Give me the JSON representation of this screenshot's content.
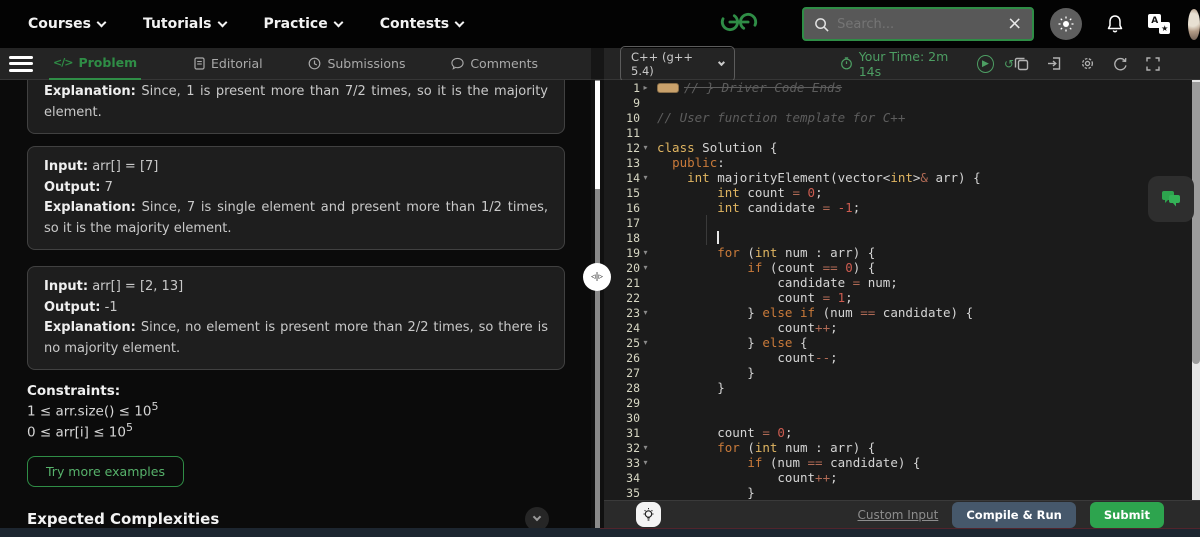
{
  "colors": {
    "brand_green": "#2f8d46",
    "timer_green": "#4d9e63",
    "submit_green": "#2da44e",
    "compile_blue": "#46586b",
    "keyword_orange": "#c97a3a",
    "type_gold": "#e0b561",
    "number_red": "#cd5c50"
  },
  "topnav": {
    "items": [
      "Courses",
      "Tutorials",
      "Practice",
      "Contests"
    ],
    "search_placeholder": "Search...",
    "search_value": "",
    "clear_glyph": "×"
  },
  "tabs": {
    "problem_icon": "</>",
    "problem": "Problem",
    "editorial": "Editorial",
    "submissions": "Submissions",
    "comments": "Comments"
  },
  "problem": {
    "partial": {
      "bold": "Explanation:",
      "text": " Since, 1 is present more than 7/2 times, so it is the majority element."
    },
    "examples": [
      {
        "input_label": "Input:",
        "input": " arr[] = [7]",
        "output_label": "Output:",
        "output": " 7",
        "expl_label": "Explanation:",
        "expl": " Since, 7 is single element and present more than 1/2 times, so it is the majority element."
      },
      {
        "input_label": "Input:",
        "input": " arr[] = [2, 13]",
        "output_label": "Output:",
        "output": " -1",
        "expl_label": "Explanation:",
        "expl": " Since, no element is present more than 2/2 times, so there is no majority element."
      }
    ],
    "constraints_label": "Constraints:",
    "constraints": [
      {
        "pre": "1 ≤ arr.size() ≤ 10",
        "sup": "5"
      },
      {
        "pre": "0 ≤ arr[i] ≤ 10",
        "sup": "5"
      }
    ],
    "try_more": "Try more examples",
    "expected_complexities": "Expected Complexities"
  },
  "editor": {
    "language": "C++ (g++ 5.4)",
    "timer_label": "Your Time: 2m 14s",
    "play_glyph": "▶",
    "history_glyph": "↺",
    "fold_open_glyph": "▾",
    "fold_closed_glyph": "▸",
    "handle_glyph": "◃|▹",
    "lines": [
      {
        "n": "1",
        "fold": "closed",
        "badge": true,
        "struck": true,
        "tokens": [
          [
            "cmt",
            "// } Driver Code Ends"
          ]
        ]
      },
      {
        "n": "9",
        "tokens": []
      },
      {
        "n": "10",
        "tokens": [
          [
            "cmt",
            "// User function template for C++"
          ]
        ]
      },
      {
        "n": "11",
        "tokens": []
      },
      {
        "n": "12",
        "fold": "open",
        "tokens": [
          [
            "type",
            "class"
          ],
          [
            "pl",
            " Solution {"
          ]
        ]
      },
      {
        "n": "13",
        "tokens": [
          [
            "pl",
            "  "
          ],
          [
            "kw",
            "public"
          ],
          [
            "pl",
            ":"
          ]
        ]
      },
      {
        "n": "14",
        "fold": "open",
        "tokens": [
          [
            "pl",
            "    "
          ],
          [
            "type",
            "int"
          ],
          [
            "pl",
            " majorityElement(vector<"
          ],
          [
            "type",
            "int"
          ],
          [
            "pl",
            ">"
          ],
          [
            "op",
            "&"
          ],
          [
            "pl",
            " arr) {"
          ]
        ]
      },
      {
        "n": "15",
        "tokens": [
          [
            "pl",
            "        "
          ],
          [
            "type",
            "int"
          ],
          [
            "pl",
            " count "
          ],
          [
            "op",
            "="
          ],
          [
            "pl",
            " "
          ],
          [
            "num",
            "0"
          ],
          [
            "pl",
            ";"
          ]
        ]
      },
      {
        "n": "16",
        "tokens": [
          [
            "pl",
            "        "
          ],
          [
            "type",
            "int"
          ],
          [
            "pl",
            " candidate "
          ],
          [
            "op",
            "="
          ],
          [
            "pl",
            " "
          ],
          [
            "num",
            "-1"
          ],
          [
            "pl",
            ";"
          ]
        ]
      },
      {
        "n": "17",
        "guide": true,
        "tokens": []
      },
      {
        "n": "18",
        "guide": true,
        "cursor": true,
        "tokens": [
          [
            "pl",
            "        "
          ]
        ]
      },
      {
        "n": "19",
        "fold": "open",
        "tokens": [
          [
            "pl",
            "        "
          ],
          [
            "kw",
            "for"
          ],
          [
            "pl",
            " ("
          ],
          [
            "type",
            "int"
          ],
          [
            "pl",
            " num : arr) {"
          ]
        ]
      },
      {
        "n": "20",
        "fold": "open",
        "tokens": [
          [
            "pl",
            "            "
          ],
          [
            "kw",
            "if"
          ],
          [
            "pl",
            " (count "
          ],
          [
            "op",
            "=="
          ],
          [
            "pl",
            " "
          ],
          [
            "num",
            "0"
          ],
          [
            "pl",
            ") {"
          ]
        ]
      },
      {
        "n": "21",
        "tokens": [
          [
            "pl",
            "                candidate "
          ],
          [
            "op",
            "="
          ],
          [
            "pl",
            " num;"
          ]
        ]
      },
      {
        "n": "22",
        "tokens": [
          [
            "pl",
            "                count "
          ],
          [
            "op",
            "="
          ],
          [
            "pl",
            " "
          ],
          [
            "num",
            "1"
          ],
          [
            "pl",
            ";"
          ]
        ]
      },
      {
        "n": "23",
        "fold": "open",
        "tokens": [
          [
            "pl",
            "            } "
          ],
          [
            "kw",
            "else"
          ],
          [
            "pl",
            " "
          ],
          [
            "kw",
            "if"
          ],
          [
            "pl",
            " (num "
          ],
          [
            "op",
            "=="
          ],
          [
            "pl",
            " candidate) {"
          ]
        ]
      },
      {
        "n": "24",
        "tokens": [
          [
            "pl",
            "                count"
          ],
          [
            "op",
            "++"
          ],
          [
            "pl",
            ";"
          ]
        ]
      },
      {
        "n": "25",
        "fold": "open",
        "tokens": [
          [
            "pl",
            "            } "
          ],
          [
            "kw",
            "else"
          ],
          [
            "pl",
            " {"
          ]
        ]
      },
      {
        "n": "26",
        "tokens": [
          [
            "pl",
            "                count"
          ],
          [
            "op",
            "--"
          ],
          [
            "pl",
            ";"
          ]
        ]
      },
      {
        "n": "27",
        "tokens": [
          [
            "pl",
            "            }"
          ]
        ]
      },
      {
        "n": "28",
        "tokens": [
          [
            "pl",
            "        }"
          ]
        ]
      },
      {
        "n": "29",
        "tokens": []
      },
      {
        "n": "30",
        "tokens": []
      },
      {
        "n": "31",
        "tokens": [
          [
            "pl",
            "        count "
          ],
          [
            "op",
            "="
          ],
          [
            "pl",
            " "
          ],
          [
            "num",
            "0"
          ],
          [
            "pl",
            ";"
          ]
        ]
      },
      {
        "n": "32",
        "fold": "open",
        "tokens": [
          [
            "pl",
            "        "
          ],
          [
            "kw",
            "for"
          ],
          [
            "pl",
            " ("
          ],
          [
            "type",
            "int"
          ],
          [
            "pl",
            " num : arr) {"
          ]
        ]
      },
      {
        "n": "33",
        "fold": "open",
        "tokens": [
          [
            "pl",
            "            "
          ],
          [
            "kw",
            "if"
          ],
          [
            "pl",
            " (num "
          ],
          [
            "op",
            "=="
          ],
          [
            "pl",
            " candidate) {"
          ]
        ]
      },
      {
        "n": "34",
        "tokens": [
          [
            "pl",
            "                count"
          ],
          [
            "op",
            "++"
          ],
          [
            "pl",
            ";"
          ]
        ]
      },
      {
        "n": "35",
        "tokens": [
          [
            "pl",
            "            }"
          ]
        ]
      }
    ],
    "footer": {
      "custom_input": "Custom Input",
      "compile_run": "Compile & Run",
      "submit": "Submit"
    }
  }
}
